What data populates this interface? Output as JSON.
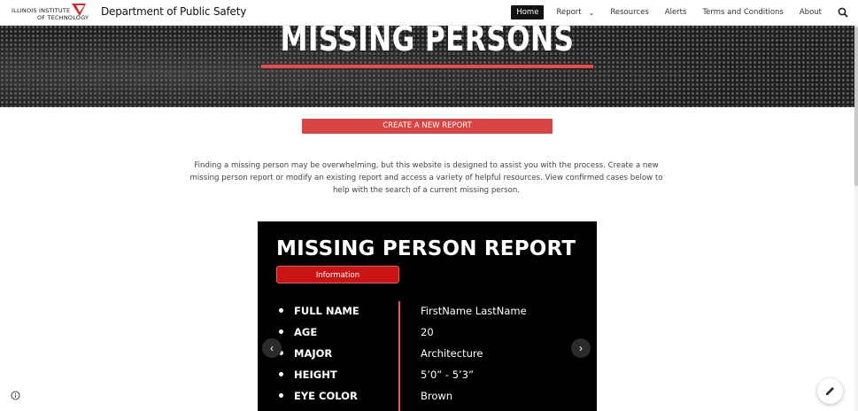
{
  "header": {
    "logo_line1": "ILLINOIS INSTITUTE",
    "logo_line2": "OF TECHNOLOGY",
    "site_title": "Department of Public Safety",
    "nav": [
      {
        "label": "Home",
        "active": true
      },
      {
        "label": "Report",
        "has_dropdown": true
      },
      {
        "label": "Resources"
      },
      {
        "label": "Alerts"
      },
      {
        "label": "Terms and Conditions"
      },
      {
        "label": "About"
      }
    ],
    "search_icon": "search-icon"
  },
  "hero": {
    "title": "MISSING PERSONS",
    "underline_color": "#ef4a4a"
  },
  "main": {
    "create_button_label": "CREATE A NEW REPORT",
    "intro_text": "Finding a missing person may be overwhelming, but this website is designed to assist you with the process. Create a new missing person report or modify an existing report and access a variety of helpful resources. View confirmed cases below to help with the search of a current missing person."
  },
  "carousel": {
    "title": "MISSING PERSON REPORT",
    "tab_label": "Information",
    "fields": [
      {
        "label": "FULL NAME",
        "value": "FirstName LastName"
      },
      {
        "label": "AGE",
        "value": "20"
      },
      {
        "label": "MAJOR",
        "value": "Architecture"
      },
      {
        "label": "HEIGHT",
        "value": "5’0” - 5’3”"
      },
      {
        "label": "EYE COLOR",
        "value": "Brown"
      }
    ],
    "prev_icon": "chevron-left-icon",
    "next_icon": "chevron-right-icon"
  },
  "colors": {
    "accent": "#d94444",
    "tab_red": "#c91414",
    "nav_active_bg": "#111111"
  }
}
